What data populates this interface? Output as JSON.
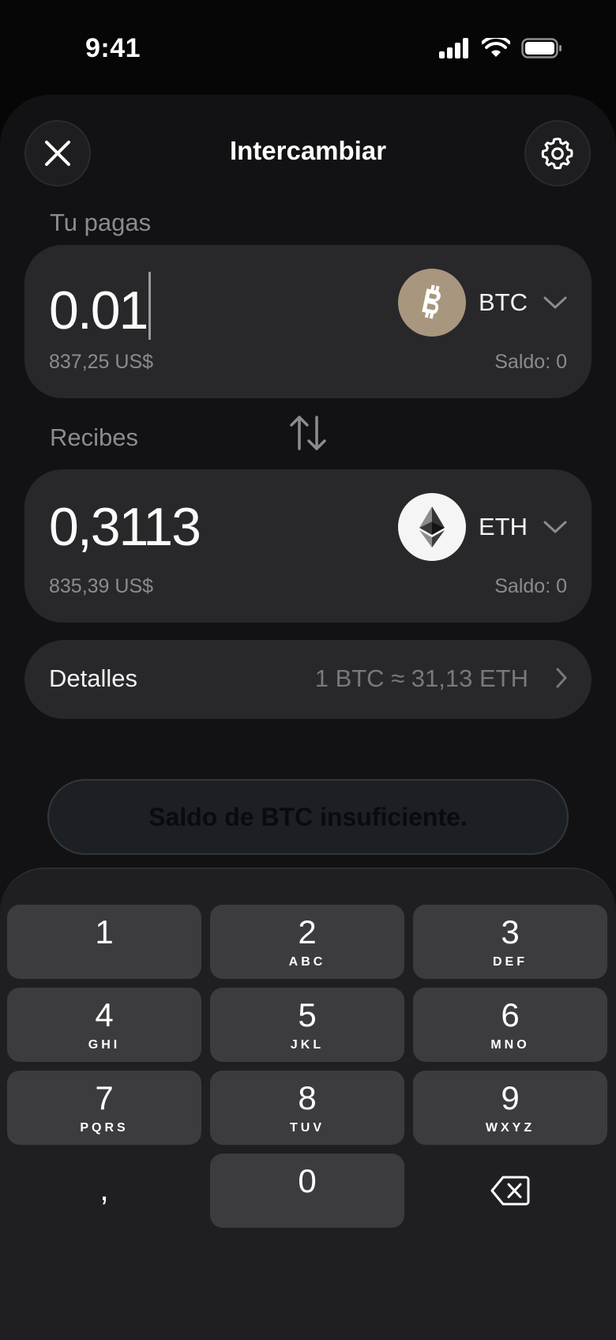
{
  "status": {
    "time": "9:41"
  },
  "header": {
    "title": "Intercambiar",
    "close_icon": "close-icon",
    "settings_icon": "gear-icon"
  },
  "pay": {
    "label": "Tu pagas",
    "amount": "0.01",
    "fiat": "837,25 US$",
    "token": "BTC",
    "token_icon": "bitcoin-icon",
    "token_color": "#a8977e",
    "balance": "Saldo: 0"
  },
  "receive": {
    "label": "Recibes",
    "amount": "0,3113",
    "fiat": "835,39 US$",
    "token": "ETH",
    "token_icon": "ethereum-icon",
    "token_color": "#f5f5f5",
    "balance": "Saldo: 0"
  },
  "swap_icon": "swap-arrows-icon",
  "details": {
    "label": "Detalles",
    "rate": "1 BTC ≈ 31,13 ETH"
  },
  "action": {
    "label": "Saldo de BTC insuficiente."
  },
  "keypad": {
    "keys": [
      {
        "digit": "1",
        "letters": ""
      },
      {
        "digit": "2",
        "letters": "ABC"
      },
      {
        "digit": "3",
        "letters": "DEF"
      },
      {
        "digit": "4",
        "letters": "GHI"
      },
      {
        "digit": "5",
        "letters": "JKL"
      },
      {
        "digit": "6",
        "letters": "MNO"
      },
      {
        "digit": "7",
        "letters": "PQRS"
      },
      {
        "digit": "8",
        "letters": "TUV"
      },
      {
        "digit": "9",
        "letters": "WXYZ"
      },
      {
        "digit": ",",
        "letters": ""
      },
      {
        "digit": "0",
        "letters": ""
      }
    ],
    "delete_icon": "backspace-icon"
  }
}
